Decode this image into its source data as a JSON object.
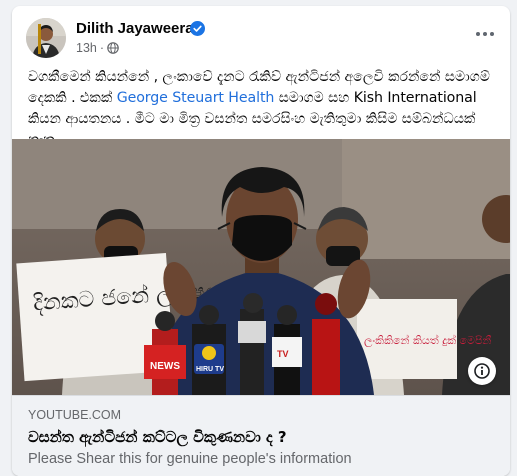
{
  "post": {
    "author": "Dilith Jayaweera",
    "time": "13h",
    "dot": "·",
    "text_part1": "වගකීමෙන් කියන්නේ , ලංකාවේ දැනට රැකිව් ඇන්ටිජන් අලෙවි කරන්නේ සමාගම් දෙකකි . එකක් ",
    "link_text": "George Steuart Health",
    "text_part2": " සමාගම සහ Kish International කියන ආයතනය . මීට මා මිත්‍ර වසන්ත සමරසිංහ මැතිතුමා කිසිම සම්බන්ධයක් නැත.",
    "icons": {
      "verified": "verified-badge-icon",
      "audience": "globe-icon",
      "more": "more-options-icon",
      "info": "info-icon"
    }
  },
  "image_scene": {
    "sign_left": "දිනකට ජනේ ලක්ෂයක් ස",
    "sign_right": "ලංකිකිනේ කියත් දුක් මෙපිනී",
    "mic_labels": [
      "NEWS",
      "HIRU TV",
      "TV"
    ]
  },
  "link_preview": {
    "domain": "YOUTUBE.COM",
    "title": "වසන්ත ඇන්ටිජන් කට්ටල විකුණනවා ද ?",
    "description": "Please Shear this for genuine people's information"
  },
  "colors": {
    "link": "#216fdb",
    "verified": "#1b74e4",
    "secondary_text": "#65676b",
    "preview_bg": "#f0f2f5"
  }
}
